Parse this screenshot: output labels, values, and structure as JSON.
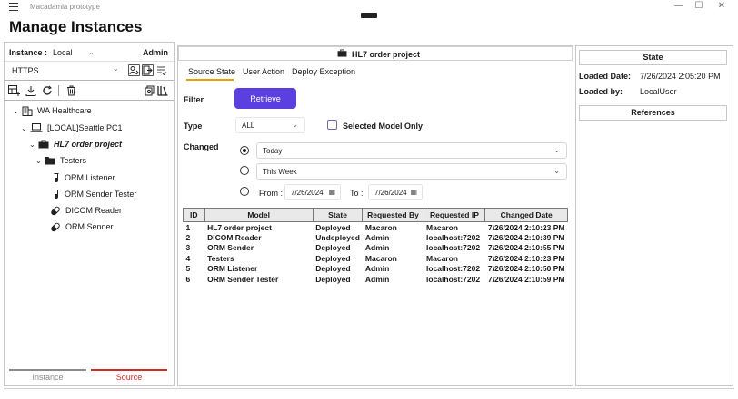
{
  "app": {
    "title": "Macadamia prototype",
    "page_title": "Manage Instances"
  },
  "window_controls": {
    "minimize": "—",
    "maximize": "☐",
    "close": "✕"
  },
  "left": {
    "instance_label": "Instance :",
    "instance_value": "Local",
    "user": "Admin",
    "protocol": "HTTPS",
    "tree": [
      {
        "label": "WA Healthcare",
        "icon": "building-icon",
        "expanded": true
      },
      {
        "label": "[LOCAL]Seattle PC1",
        "icon": "laptop-icon",
        "expanded": true
      },
      {
        "label": "HL7 order project",
        "icon": "briefcase-icon",
        "expanded": true
      },
      {
        "label": "Testers",
        "icon": "folder-icon",
        "expanded": true
      },
      {
        "label": "ORM Listener",
        "icon": "test-tube-icon"
      },
      {
        "label": "ORM Sender Tester",
        "icon": "test-tube-icon"
      },
      {
        "label": "DICOM Reader",
        "icon": "capsule-icon"
      },
      {
        "label": "ORM Sender",
        "icon": "capsule-icon"
      }
    ],
    "bottom_tabs": [
      {
        "label": "Instance",
        "color": "#8a8a8a"
      },
      {
        "label": "Source",
        "color": "#d12a2a"
      }
    ]
  },
  "mid": {
    "header": "HL7 order project",
    "tabs": [
      "Source State",
      "User Action",
      "Deploy Exception"
    ],
    "active_tab_color": "#e2a200",
    "filter_label": "Filter",
    "retrieve": "Retrieve",
    "type_label": "Type",
    "type_value": "ALL",
    "selected_model_only": "Selected Model Only",
    "changed_label": "Changed",
    "changed_options": [
      "Today",
      "This Week"
    ],
    "from_label": "From :",
    "from_date": "7/26/2024",
    "to_label": "To :",
    "to_date": "7/26/2024",
    "columns": [
      "ID",
      "Model",
      "State",
      "Requested By",
      "Requested IP",
      "Changed Date"
    ],
    "rows": [
      [
        "1",
        "HL7 order project",
        "Deployed",
        "Macaron",
        "Macaron",
        "7/26/2024 2:10:23 PM"
      ],
      [
        "2",
        "DICOM Reader",
        "Undeployed",
        "Admin",
        "localhost:7202",
        "7/26/2024 2:10:39 PM"
      ],
      [
        "3",
        "ORM Sender",
        "Deployed",
        "Admin",
        "localhost:7202",
        "7/26/2024 2:10:55 PM"
      ],
      [
        "4",
        "Testers",
        "Deployed",
        "Macaron",
        "Macaron",
        "7/26/2024 2:10:23 PM"
      ],
      [
        "5",
        "ORM Listener",
        "Deployed",
        "Admin",
        "localhost:7202",
        "7/26/2024 2:10:50 PM"
      ],
      [
        "6",
        "ORM Sender Tester",
        "Deployed",
        "Admin",
        "localhost:7202",
        "7/26/2024 2:10:59 PM"
      ]
    ]
  },
  "right": {
    "state_header": "State",
    "loaded_date_label": "Loaded Date:",
    "loaded_date": "7/26/2024 2:05:20 PM",
    "loaded_by_label": "Loaded by:",
    "loaded_by": "LocalUser",
    "references_header": "References"
  },
  "colors": {
    "accent": "#5b3fe0",
    "border": "#c8c8c8"
  }
}
